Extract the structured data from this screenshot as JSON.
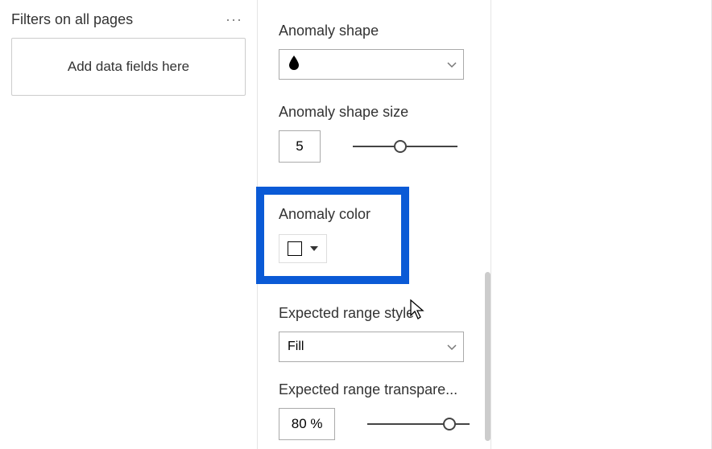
{
  "filters": {
    "title": "Filters on all pages",
    "placeholder": "Add data fields here"
  },
  "format": {
    "anomaly_shape": {
      "label": "Anomaly shape",
      "value_glyph": "droplet"
    },
    "anomaly_shape_size": {
      "label": "Anomaly shape size",
      "value": "5",
      "slider_pct": 45
    },
    "anomaly_color": {
      "label": "Anomaly color",
      "swatch": "#ffffff"
    },
    "expected_range_style": {
      "label": "Expected range style",
      "value": "Fill"
    },
    "expected_range_transparency": {
      "label": "Expected range transpare...",
      "value": "80  %",
      "slider_pct": 80
    }
  }
}
